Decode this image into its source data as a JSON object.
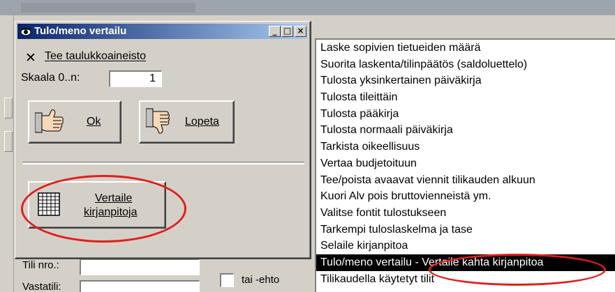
{
  "dialog": {
    "title": "Tulo/meno vertailu",
    "title_buttons": {
      "minimize": "_",
      "maximize": "□",
      "close": "×"
    },
    "checkbox_label": "Tee taulukkoaineisto",
    "checkbox_checked": true,
    "scale_label": "Skaala 0..n:",
    "scale_value": "1",
    "ok_label": "Ok",
    "cancel_label": "Lopeta",
    "compare_line1": "Vertaile",
    "compare_line2": "kirjanpitoja"
  },
  "list": {
    "items": [
      "Laske sopivien tietueiden määrä",
      "Suorita laskenta/tilinpäätös (saldoluettelo)",
      "Tulosta yksinkertainen päiväkirja",
      "Tulosta tileittäin",
      "Tulosta pääkirja",
      "Tulosta normaali päiväkirja",
      "Tarkista oikeellisuus",
      "Vertaa budjetoituun",
      "Tee/poista avaavat viennit tilikauden alkuun",
      "Kuori Alv pois bruttovienneistä ym.",
      "Valitse fontit tulostukseen",
      "Tarkempi tuloslaskelma ja tase",
      "Selaile kirjanpitoa",
      "Tulo/meno vertailu - Vertaile kahta kirjanpitoa",
      "Tilikaudella käytetyt tilit"
    ],
    "selected_index": 13
  },
  "fields": {
    "account_label": "Tili nro.:",
    "counter_label": "Vastatili:",
    "or_condition_label": "tai -ehto"
  },
  "colors": {
    "highlight": "#e01e1e",
    "selection": "#000000",
    "title_start": "#0a246a",
    "title_end": "#a6caf0"
  }
}
